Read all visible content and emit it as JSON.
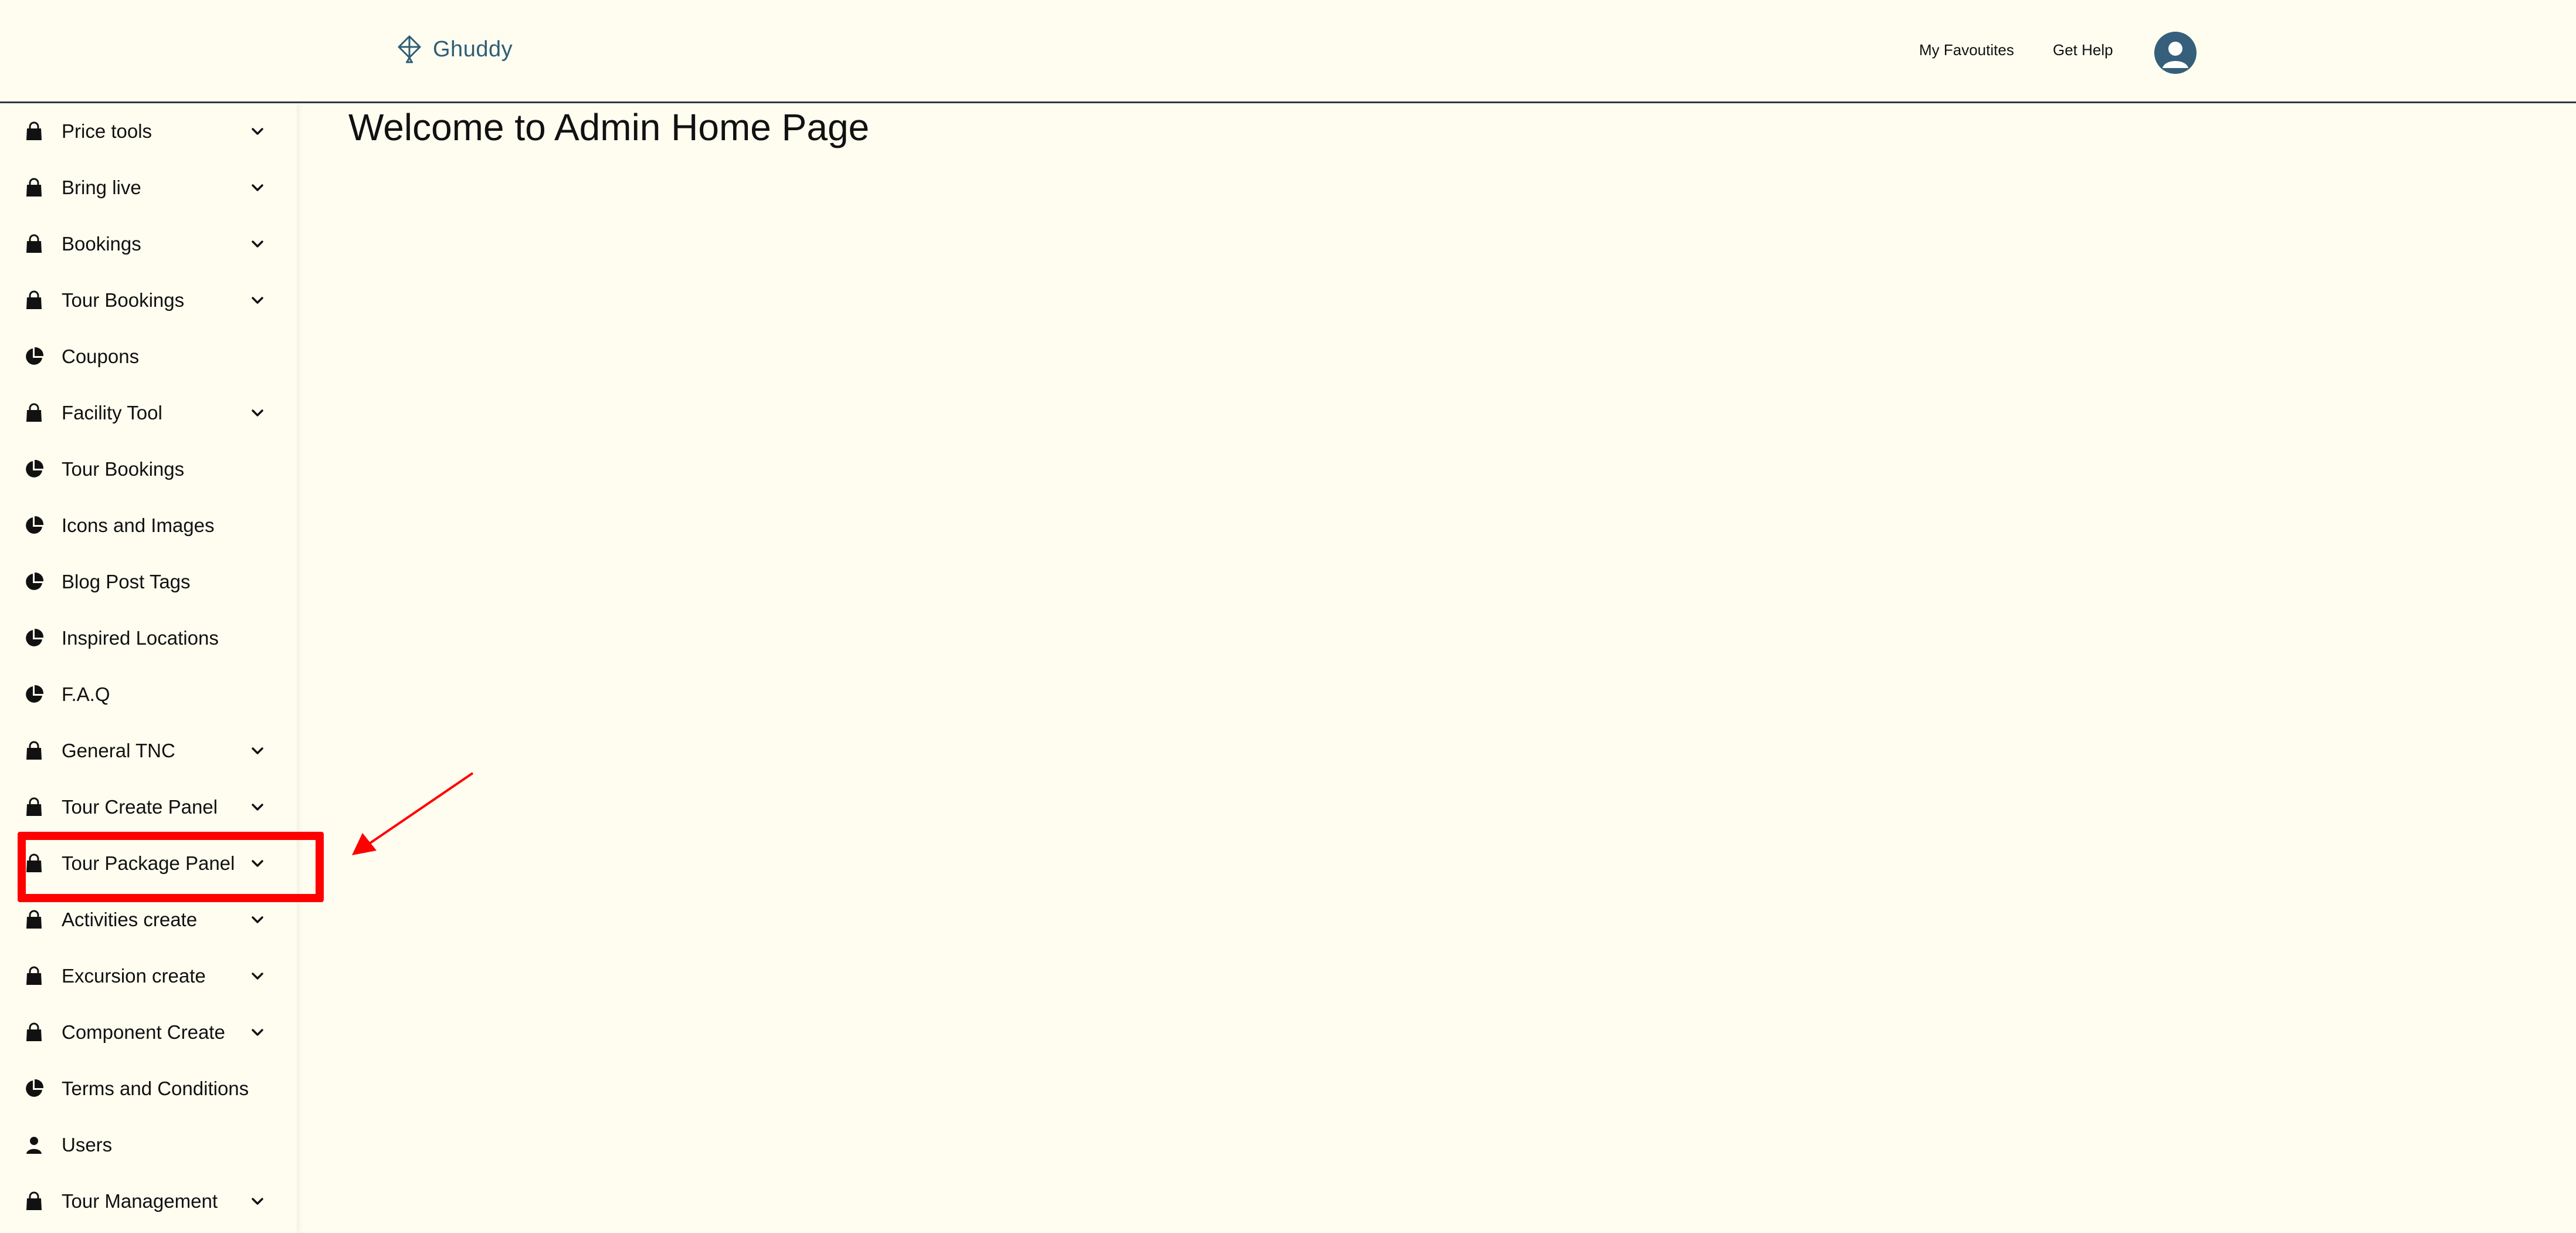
{
  "header": {
    "brand": "Ghuddy",
    "links": {
      "favourites": "My Favoutites",
      "help": "Get Help"
    },
    "colors": {
      "brand": "#2E5E76",
      "avatar": "#355F7A"
    }
  },
  "sidebar": {
    "items": [
      {
        "label": "Price tools",
        "icon": "bag-icon",
        "expandable": true
      },
      {
        "label": "Bring live",
        "icon": "bag-icon",
        "expandable": true
      },
      {
        "label": "Bookings",
        "icon": "bag-icon",
        "expandable": true
      },
      {
        "label": "Tour Bookings",
        "icon": "bag-icon",
        "expandable": true
      },
      {
        "label": "Coupons",
        "icon": "pie-chart-icon",
        "expandable": false
      },
      {
        "label": "Facility Tool",
        "icon": "bag-icon",
        "expandable": true
      },
      {
        "label": "Tour Bookings",
        "icon": "pie-chart-icon",
        "expandable": false
      },
      {
        "label": "Icons and Images",
        "icon": "pie-chart-icon",
        "expandable": false
      },
      {
        "label": "Blog Post Tags",
        "icon": "pie-chart-icon",
        "expandable": false
      },
      {
        "label": "Inspired Locations",
        "icon": "pie-chart-icon",
        "expandable": false
      },
      {
        "label": "F.A.Q",
        "icon": "pie-chart-icon",
        "expandable": false
      },
      {
        "label": "General TNC",
        "icon": "bag-icon",
        "expandable": true
      },
      {
        "label": "Tour Create Panel",
        "icon": "bag-icon",
        "expandable": true
      },
      {
        "label": "Tour Package Panel",
        "icon": "bag-icon",
        "expandable": true
      },
      {
        "label": "Activities create",
        "icon": "bag-icon",
        "expandable": true
      },
      {
        "label": "Excursion create",
        "icon": "bag-icon",
        "expandable": true
      },
      {
        "label": "Component Create",
        "icon": "bag-icon",
        "expandable": true
      },
      {
        "label": "Terms and Conditions",
        "icon": "pie-chart-icon",
        "expandable": false
      },
      {
        "label": "Users",
        "icon": "user-icon",
        "expandable": false
      },
      {
        "label": "Tour Management",
        "icon": "bag-icon",
        "expandable": true
      }
    ]
  },
  "main": {
    "title": "Welcome to Admin Home Page"
  },
  "annotation": {
    "highlighted_item": "Tour Package Panel",
    "color": "#FF0000"
  }
}
